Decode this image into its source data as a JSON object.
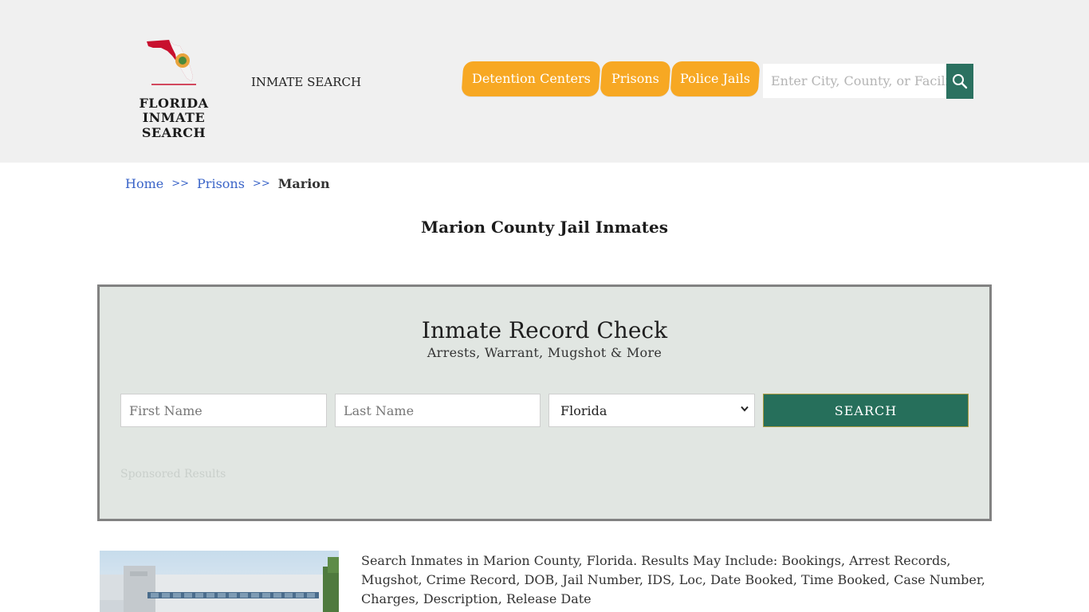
{
  "header": {
    "logo_line1": "FLORIDA",
    "logo_line2": "INMATE SEARCH",
    "site_title": "INMATE SEARCH",
    "nav": [
      {
        "label": "Detention Centers"
      },
      {
        "label": "Prisons"
      },
      {
        "label": "Police Jails"
      }
    ],
    "search_placeholder": "Enter City, County, or Facility",
    "search_icon": "search-icon"
  },
  "breadcrumb": {
    "items": [
      {
        "label": "Home"
      },
      {
        "label": "Prisons"
      },
      {
        "label": "Marion"
      }
    ],
    "separator": ">>"
  },
  "page": {
    "title": "Marion County Jail Inmates"
  },
  "record_check": {
    "title": "Inmate Record Check",
    "subtitle": "Arrests, Warrant, Mugshot & More",
    "first_name_placeholder": "First Name",
    "last_name_placeholder": "Last Name",
    "state_selected": "Florida",
    "submit_label": "SEARCH",
    "sponsored_label": "Sponsored Results"
  },
  "content": {
    "description": "Search Inmates in Marion County, Florida. Results May Include: Bookings, Arrest Records, Mugshot, Crime Record, DOB, Jail Number, IDS, Loc, Date Booked, Time Booked, Case Number, Charges, Description, Release Date"
  },
  "colors": {
    "header_bg": "#f0f0f0",
    "nav_tab": "#f7a823",
    "accent_green": "#266f5b",
    "panel_bg": "#e1e6e2",
    "link_blue": "#3a64c8"
  }
}
